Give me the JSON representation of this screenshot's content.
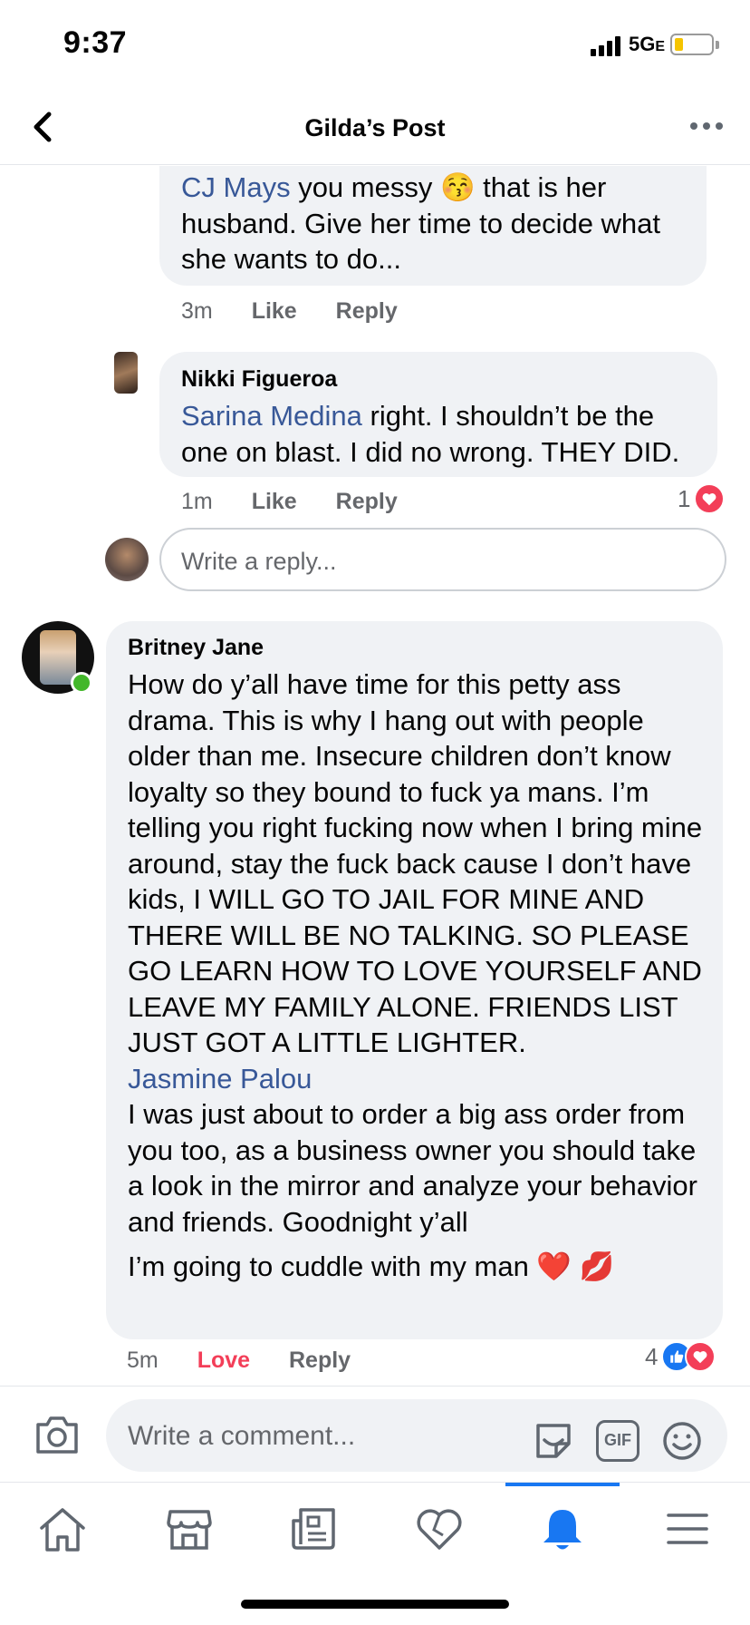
{
  "status_bar": {
    "time": "9:37",
    "network": "5G",
    "network_suffix": "E",
    "battery_level": 0.22
  },
  "header": {
    "title": "Gilda’s Post",
    "back_icon": "chevron-left-icon",
    "more_icon": "more-dots-icon"
  },
  "comments": [
    {
      "mention": "CJ Mays",
      "text": " you messy 😚 that is her husband. Give her time to decide what she wants to do...",
      "time": "3m",
      "like": "Like",
      "reply": "Reply"
    },
    {
      "author": "Nikki Figueroa",
      "mention": "Sarina Medina",
      "text": " right. I shouldn’t be the one on blast. I did no wrong. THEY DID.",
      "time": "1m",
      "like": "Like",
      "reply": "Reply",
      "reaction_count": "1"
    },
    {
      "author": "Britney Jane",
      "text": "How do y’all have time for this petty ass drama. This is why I hang out with people older than me. Insecure children don’t know loyalty so they bound to fuck ya mans. I’m telling you right fucking now when I bring mine around, stay the fuck back cause I don’t have kids, I WILL GO TO JAIL FOR MINE AND THERE WILL BE NO TALKING. SO PLEASE GO LEARN HOW TO LOVE YOURSELF AND LEAVE MY FAMILY ALONE. FRIENDS LIST JUST GOT A LITTLE LIGHTER.",
      "mention": "Jasmine Palou",
      "text2": "I was just about to order a big ass order from you too, as a business owner you should take a look in the mirror and analyze your behavior and friends. Goodnight y’all",
      "text3": "I’m going to cuddle with my man ❤️ 💋",
      "time": "5m",
      "love": "Love",
      "reply": "Reply",
      "reaction_count": "4"
    }
  ],
  "reply_input": {
    "placeholder": "Write a reply..."
  },
  "comment_bar": {
    "placeholder": "Write a comment...",
    "gif_label": "GIF"
  },
  "tabs": [
    "home-icon",
    "marketplace-icon",
    "news-icon",
    "dating-heart-icon",
    "notifications-bell-icon",
    "menu-icon"
  ],
  "colors": {
    "accent": "#1877f2",
    "mention": "#385898",
    "love": "#f33e58",
    "online": "#42b72a"
  }
}
